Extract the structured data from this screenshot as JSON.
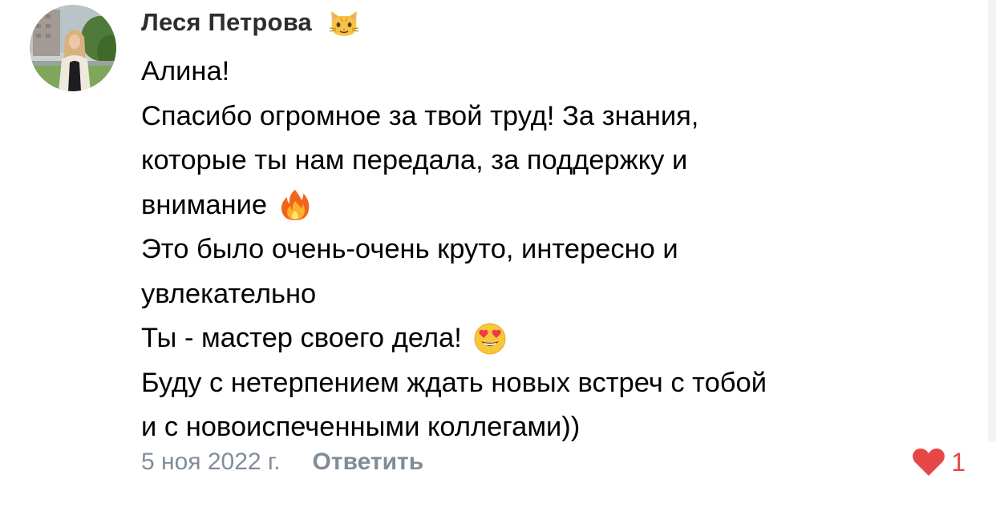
{
  "comment": {
    "author_name": "Леся Петрова",
    "author_badge_icon": "cat-face-icon",
    "text_lines": [
      "Алина!",
      "Спасибо огромное за твой труд! За знания,",
      "которые ты нам передала, за поддержку и",
      "внимание",
      "Это было очень-очень круто, интересно и",
      "увлекательно",
      "Ты - мастер своего дела!",
      "Буду с нетерпением ждать новых встреч с тобой",
      "и с новоиспеченными коллегами))"
    ],
    "inline_icons": [
      "fire-emoji-icon",
      "heart-eyes-emoji-icon"
    ],
    "date": "5 ноя 2022 г.",
    "reply_label": "Ответить",
    "likes_count": "1",
    "like_icon": "heart-icon"
  },
  "colors": {
    "text": "#000000",
    "author": "#2c2d2e",
    "secondary": "#818c99",
    "like_accent": "#e64646"
  }
}
